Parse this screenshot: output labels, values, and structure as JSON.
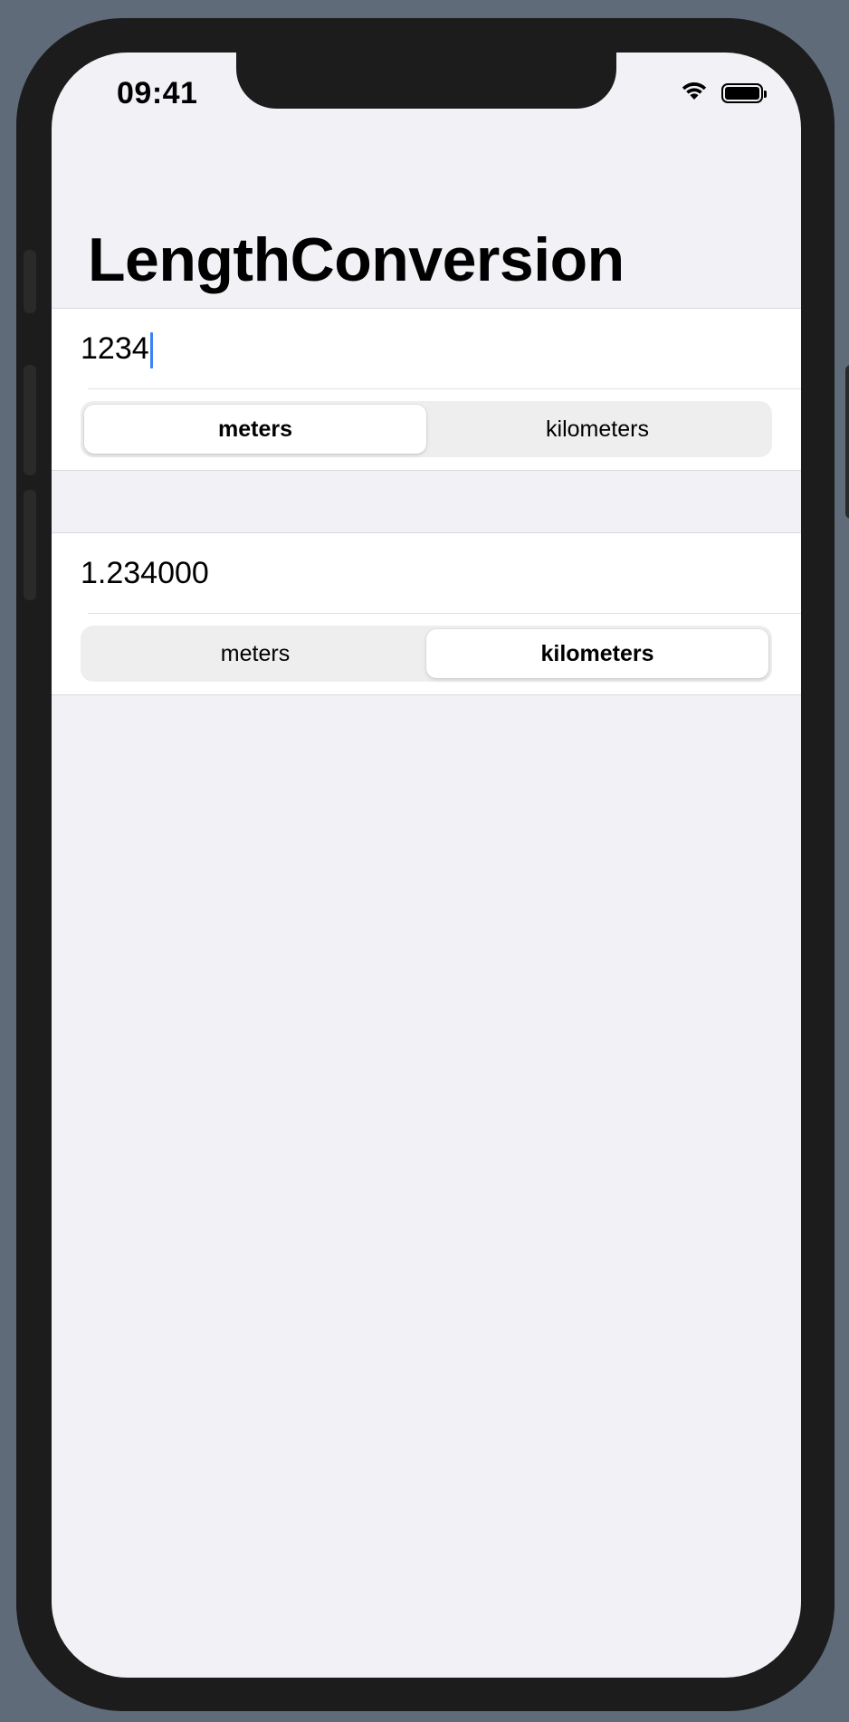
{
  "status_bar": {
    "time": "09:41"
  },
  "nav": {
    "title": "LengthConversion"
  },
  "input_section": {
    "value": "1234",
    "units": [
      "meters",
      "kilometers"
    ],
    "selected_unit": "meters"
  },
  "output_section": {
    "value": "1.234000",
    "units": [
      "meters",
      "kilometers"
    ],
    "selected_unit": "kilometers"
  },
  "colors": {
    "background": "#f1f1f6",
    "caret": "#3b82f6",
    "device_frame": "#1c1c1d",
    "backdrop": "#5f6b78"
  },
  "icons": [
    "wifi-icon",
    "battery-icon"
  ]
}
